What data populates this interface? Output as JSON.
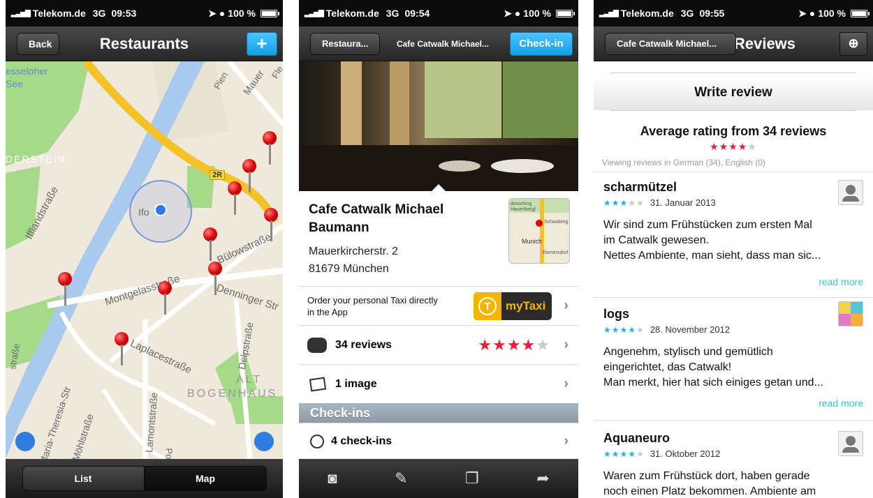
{
  "screens": [
    {
      "status": {
        "carrier": "Telekom.de",
        "network": "3G",
        "time": "09:53",
        "battery": "100 %"
      },
      "nav": {
        "back": "Back",
        "title": "Restaurants",
        "add_icon": "+"
      },
      "map": {
        "labels": {
          "lake1": "esseloher",
          "lake2": "See",
          "area1": "DERSTEIN",
          "road_2r": "2R",
          "pienz": "Pien",
          "mauer": "Mauer",
          "fle": "Fle",
          "ifo": "Ifo",
          "iffland": "Ifflandstraße",
          "buelow": "Bülowstraße",
          "montgelas": "Montgelasstraße",
          "denninger": "Denninger Str",
          "laplace": "Laplacestraße",
          "delp": "Delpstraße",
          "alt": "ALT",
          "bogenh": "BOGENHAUS",
          "maria": "Maria-Theresia-Str",
          "moehl": "Möhlstraße",
          "lamont": "Lamontstraße",
          "ssse": "straße",
          "po": "Po"
        }
      },
      "segments": {
        "list": "List",
        "map": "Map"
      }
    },
    {
      "status": {
        "carrier": "Telekom.de",
        "network": "3G",
        "time": "09:54",
        "battery": "100 %"
      },
      "nav": {
        "back": "Restaura...",
        "title": "Cafe Catwalk Michael...",
        "action": "Check-in"
      },
      "place": {
        "name_line1": "Cafe Catwalk Michael",
        "name_line2": "Baumann",
        "address_line1": "Mauerkircherstr. 2",
        "address_line2": "81679 München",
        "minimap_labels": [
          "dmoching",
          "Hasenbergl",
          "Schwabing",
          "Munich",
          "Ramersdorf"
        ]
      },
      "taxi": {
        "text_line1": "Order your personal Taxi directly",
        "text_line2": "in the App",
        "brand_letter": "T",
        "brand_name": "myTaxi"
      },
      "rows": {
        "reviews": "34 reviews",
        "images": "1 image",
        "checkins_header": "Check-ins",
        "checkins": "4 check-ins"
      },
      "rating": {
        "filled": 4,
        "total": 5
      }
    },
    {
      "status": {
        "carrier": "Telekom.de",
        "network": "3G",
        "time": "09:55",
        "battery": "100 %"
      },
      "nav": {
        "back": "Cafe Catwalk Michael...",
        "title": "Reviews"
      },
      "write_review": "Write review",
      "average": {
        "title": "Average rating from 34 reviews",
        "filled": 4,
        "total": 5,
        "viewing": "Viewing reviews in German (34), English (0)"
      },
      "reviews": [
        {
          "author": "scharmützel",
          "stars": 3,
          "date": "31. Januar 2013",
          "lines": [
            "Wir sind zum Frühstücken zum ersten Mal",
            "im Catwalk gewesen.",
            "Nettes Ambiente, man sieht, dass man sic..."
          ],
          "read_more": "read more"
        },
        {
          "author": "logs",
          "stars": 4,
          "date": "28. November 2012",
          "lines": [
            "Angenehm, stylisch und gemütlich",
            "eingerichtet, das Catwalk!",
            "Man merkt, hier hat sich einiges getan und..."
          ],
          "read_more": "read more"
        },
        {
          "author": "Aquaneuro",
          "stars": 4,
          "date": "31. Oktober 2012",
          "lines": [
            "Waren zum Frühstück dort, haben gerade",
            "noch einen Platz bekommen. Ambiente am"
          ]
        }
      ]
    }
  ]
}
